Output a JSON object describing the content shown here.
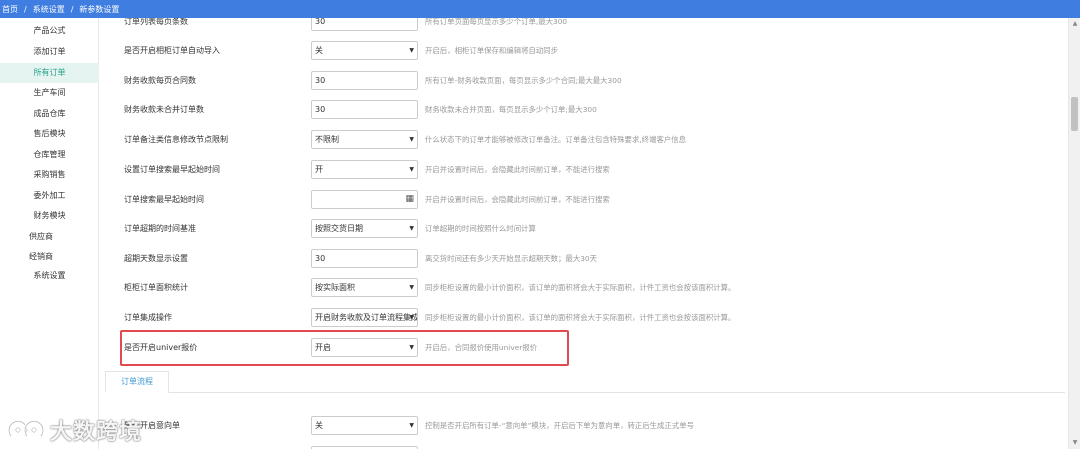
{
  "breadcrumb": {
    "items": [
      "首页",
      "系统设置",
      "新参数设置"
    ],
    "separator": "/"
  },
  "sidebar": {
    "items": [
      {
        "label": "产品公式",
        "active": false
      },
      {
        "label": "添加订单",
        "active": false
      },
      {
        "label": "所有订单",
        "active": true
      },
      {
        "label": "生产车间",
        "active": false
      },
      {
        "label": "成品仓库",
        "active": false
      },
      {
        "label": "售后模块",
        "active": false
      },
      {
        "label": "仓库管理",
        "active": false
      },
      {
        "label": "采购销售",
        "active": false
      },
      {
        "label": "委外加工",
        "active": false
      },
      {
        "label": "财务模块",
        "active": false
      },
      {
        "label": "供应商",
        "active": false
      },
      {
        "label": "经销商",
        "active": false
      },
      {
        "label": "系统设置",
        "active": false
      }
    ],
    "active_color": "#20a183"
  },
  "settings": [
    {
      "label": "订单列表每页条数",
      "control": "input",
      "value": "30",
      "hint": "所有订单页面每页显示多少个订单,最大300"
    },
    {
      "label": "是否开启相柜订单自动导入",
      "control": "select",
      "value": "关",
      "hint": "开启后，相柜订单保存和编辑将自动同步"
    },
    {
      "label": "财务收款每页合同数",
      "control": "input",
      "value": "30",
      "hint": "所有订单-财务收款页面，每页显示多少个合同;最大最大300"
    },
    {
      "label": "财务收款未合并订单数",
      "control": "input",
      "value": "30",
      "hint": "财务收款未合并页面，每页显示多少个订单;最大300"
    },
    {
      "label": "订单备注类信息修改节点限制",
      "control": "select",
      "value": "不限制",
      "hint": "什么状态下的订单才能够被修改订单备注。订单备注包含特殊要求,终端客户信息"
    },
    {
      "label": "设置订单搜索最早起始时间",
      "control": "select",
      "value": "开",
      "hint": "开启并设置时间后，会隐藏此时间前订单，不能进行搜索"
    },
    {
      "label": "订单搜索最早起始时间",
      "control": "date",
      "value": "",
      "hint": "开启并设置时间后，会隐藏此时间前订单，不能进行搜索"
    },
    {
      "label": "订单超期的时间基准",
      "control": "select",
      "value": "按照交货日期",
      "hint": "订单超期的时间按照什么时间计算"
    },
    {
      "label": "超期天数显示设置",
      "control": "input",
      "value": "30",
      "hint": "离交货时间还有多少天开始显示超期天数；最大30天"
    },
    {
      "label": "柜柜订单面积统计",
      "control": "select",
      "value": "按实际面积",
      "hint": "同步柜柜设置的最小计价面积，该订单的面积将会大于实际面积，计件工资也会按该面积计算。"
    },
    {
      "label": "订单集成操作",
      "control": "select",
      "value": "开启财务收款及订单流程集成",
      "hint": "同步柜柜设置的最小计价面积，该订单的面积将会大于实际面积，计件工资也会按该面积计算。"
    },
    {
      "label": "是否开启univer报价",
      "control": "select",
      "value": "开启",
      "hint": "开启后，合同报价使用univer报价"
    }
  ],
  "tabs": [
    {
      "label": "订单流程"
    }
  ],
  "flow_settings": [
    {
      "label": "是否开启意向单",
      "control": "select",
      "value": "关",
      "hint": "控制是否开启所有订单-“意向单”模块，开启后下单为意向单，转正后生成正式单号"
    }
  ],
  "icons": {
    "select_arrow": "▼",
    "calendar": "▦",
    "scroll_up": "▲",
    "scroll_down": "▼"
  },
  "watermark": {
    "text": "大数跨境"
  },
  "colors": {
    "header": "#3f7de0",
    "highlight": "#e04a50",
    "tab_text": "#3f9ad6"
  }
}
